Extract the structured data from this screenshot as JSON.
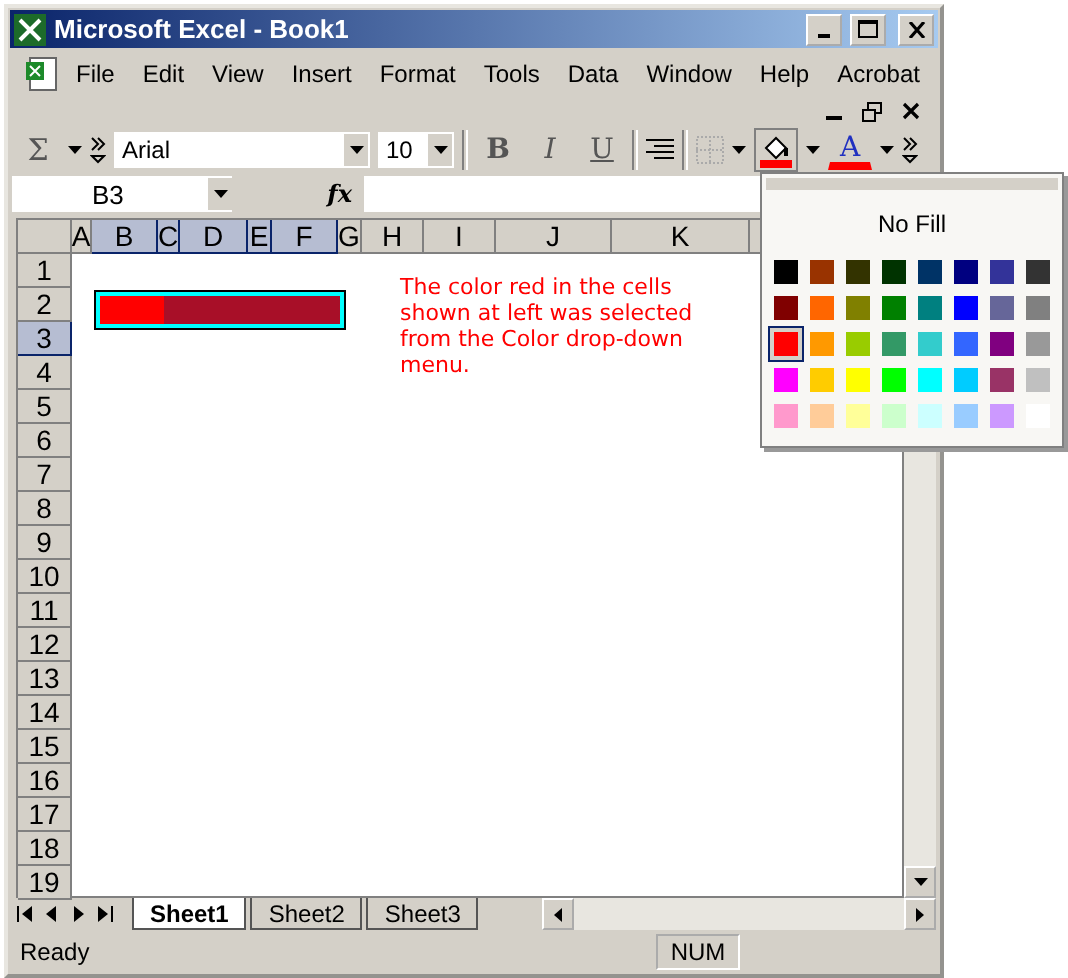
{
  "window": {
    "title": "Microsoft Excel - Book1"
  },
  "menu": [
    "File",
    "Edit",
    "View",
    "Insert",
    "Format",
    "Tools",
    "Data",
    "Window",
    "Help",
    "Acrobat"
  ],
  "toolbar": {
    "autosum": "Σ",
    "font": "Arial",
    "size": "10",
    "bold": "B",
    "italic": "I",
    "underline": "U",
    "font_color": "A"
  },
  "formula_bar": {
    "name_box": "B3",
    "fx": "fx"
  },
  "columns": [
    {
      "label": "A",
      "selected": false
    },
    {
      "label": "B",
      "selected": true
    },
    {
      "label": "C",
      "selected": true
    },
    {
      "label": "D",
      "selected": true
    },
    {
      "label": "E",
      "selected": true
    },
    {
      "label": "F",
      "selected": true
    },
    {
      "label": "G",
      "selected": false
    },
    {
      "label": "H",
      "selected": false
    },
    {
      "label": "I",
      "selected": false
    },
    {
      "label": "J",
      "selected": false
    },
    {
      "label": "K",
      "selected": false
    }
  ],
  "rows": [
    {
      "label": "1",
      "selected": false
    },
    {
      "label": "2",
      "selected": false
    },
    {
      "label": "3",
      "selected": true
    },
    {
      "label": "4",
      "selected": false
    },
    {
      "label": "5",
      "selected": false
    },
    {
      "label": "6",
      "selected": false
    },
    {
      "label": "7",
      "selected": false
    },
    {
      "label": "8",
      "selected": false
    },
    {
      "label": "9",
      "selected": false
    },
    {
      "label": "10",
      "selected": false
    },
    {
      "label": "11",
      "selected": false
    },
    {
      "label": "12",
      "selected": false
    },
    {
      "label": "13",
      "selected": false
    },
    {
      "label": "14",
      "selected": false
    },
    {
      "label": "15",
      "selected": false
    },
    {
      "label": "16",
      "selected": false
    },
    {
      "label": "17",
      "selected": false
    },
    {
      "label": "18",
      "selected": false
    },
    {
      "label": "19",
      "selected": false
    }
  ],
  "note": "The color red in the cells shown at left was selected from the Color drop-down menu.",
  "sheet_tabs": [
    {
      "label": "Sheet1",
      "selected": true
    },
    {
      "label": "Sheet2",
      "selected": false
    },
    {
      "label": "Sheet3",
      "selected": false
    }
  ],
  "status_bar": {
    "status": "Ready",
    "num": "NUM"
  },
  "fill_palette": {
    "no_fill": "No Fill",
    "swatches": [
      {
        "color": "#000000",
        "selected": false
      },
      {
        "color": "#993300",
        "selected": false
      },
      {
        "color": "#333300",
        "selected": false
      },
      {
        "color": "#003300",
        "selected": false
      },
      {
        "color": "#003366",
        "selected": false
      },
      {
        "color": "#000080",
        "selected": false
      },
      {
        "color": "#333399",
        "selected": false
      },
      {
        "color": "#333333",
        "selected": false
      },
      {
        "color": "#800000",
        "selected": false
      },
      {
        "color": "#ff6600",
        "selected": false
      },
      {
        "color": "#808000",
        "selected": false
      },
      {
        "color": "#008000",
        "selected": false
      },
      {
        "color": "#008080",
        "selected": false
      },
      {
        "color": "#0000ff",
        "selected": false
      },
      {
        "color": "#666699",
        "selected": false
      },
      {
        "color": "#808080",
        "selected": false
      },
      {
        "color": "#ff0000",
        "selected": true
      },
      {
        "color": "#ff9900",
        "selected": false
      },
      {
        "color": "#99cc00",
        "selected": false
      },
      {
        "color": "#339966",
        "selected": false
      },
      {
        "color": "#33cccc",
        "selected": false
      },
      {
        "color": "#3366ff",
        "selected": false
      },
      {
        "color": "#800080",
        "selected": false
      },
      {
        "color": "#999999",
        "selected": false
      },
      {
        "color": "#ff00ff",
        "selected": false
      },
      {
        "color": "#ffcc00",
        "selected": false
      },
      {
        "color": "#ffff00",
        "selected": false
      },
      {
        "color": "#00ff00",
        "selected": false
      },
      {
        "color": "#00ffff",
        "selected": false
      },
      {
        "color": "#00ccff",
        "selected": false
      },
      {
        "color": "#993366",
        "selected": false
      },
      {
        "color": "#c0c0c0",
        "selected": false
      },
      {
        "color": "#ff99cc",
        "selected": false
      },
      {
        "color": "#ffcc99",
        "selected": false
      },
      {
        "color": "#ffff99",
        "selected": false
      },
      {
        "color": "#ccffcc",
        "selected": false
      },
      {
        "color": "#ccffff",
        "selected": false
      },
      {
        "color": "#99ccff",
        "selected": false
      },
      {
        "color": "#cc99ff",
        "selected": false
      },
      {
        "color": "#ffffff",
        "selected": false
      }
    ]
  }
}
